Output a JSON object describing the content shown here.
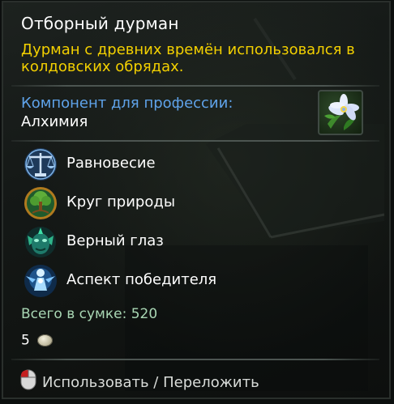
{
  "item": {
    "name": "Отборный дурман",
    "description": "Дурман с древних времён использовался в колдовских обрядах.",
    "icon": "datura-flower-icon"
  },
  "profession": {
    "label": "Компонент для профессии:",
    "value": "Алхимия"
  },
  "boons": [
    {
      "label": "Равновесие",
      "icon": "scales-icon"
    },
    {
      "label": "Круг природы",
      "icon": "tree-circle-icon"
    },
    {
      "label": "Верный глаз",
      "icon": "eye-creature-icon"
    },
    {
      "label": "Аспект победителя",
      "icon": "glowing-figure-icon"
    }
  ],
  "inventory": {
    "total": "Всего в сумке: 520",
    "count": "5",
    "currency_icon": "silver-coin-icon"
  },
  "action": {
    "label": "Использовать / Переложить",
    "icon": "mouse-icon"
  },
  "colors": {
    "title": "#ffffff",
    "description": "#f3d000",
    "profession_label": "#5fa3ea",
    "total": "#a9d7b4"
  }
}
